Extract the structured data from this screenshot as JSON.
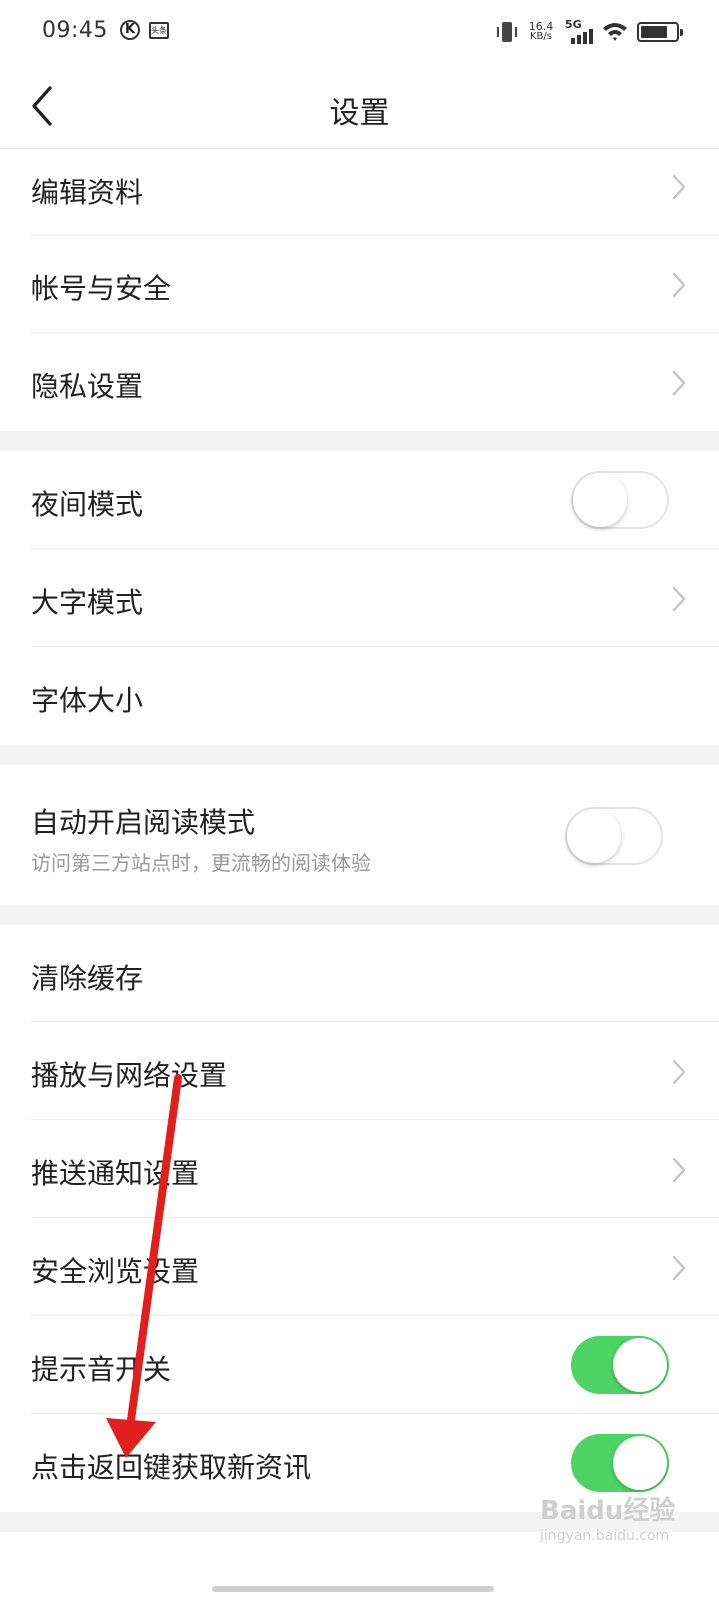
{
  "status_bar": {
    "time": "09:45",
    "k_badge": "K",
    "app_badge": "头条",
    "net_speed_value": "16.4",
    "net_speed_unit": "KB/s",
    "network_type": "5G",
    "icons": [
      "vibrate-icon",
      "signal-icon",
      "wifi-icon",
      "battery-icon"
    ],
    "battery_level": 0.75
  },
  "header": {
    "title": "设置",
    "back_icon": "chevron-left-icon"
  },
  "sections": [
    {
      "items": [
        {
          "label": "编辑资料",
          "control": "chevron"
        },
        {
          "label": "帐号与安全",
          "control": "chevron"
        },
        {
          "label": "隐私设置",
          "control": "chevron"
        }
      ]
    },
    {
      "items": [
        {
          "label": "夜间模式",
          "control": "toggle",
          "on": false
        },
        {
          "label": "大字模式",
          "control": "chevron"
        },
        {
          "label": "字体大小",
          "control": "none"
        }
      ]
    },
    {
      "items": [
        {
          "label": "自动开启阅读模式",
          "sublabel": "访问第三方站点时，更流畅的阅读体验",
          "control": "toggle",
          "on": false
        }
      ]
    },
    {
      "items": [
        {
          "label": "清除缓存",
          "control": "none"
        },
        {
          "label": "播放与网络设置",
          "control": "chevron"
        },
        {
          "label": "推送通知设置",
          "control": "chevron"
        },
        {
          "label": "安全浏览设置",
          "control": "chevron"
        },
        {
          "label": "提示音开关",
          "control": "toggle",
          "on": true
        },
        {
          "label": "点击返回键获取新资讯",
          "control": "toggle",
          "on": true
        }
      ]
    }
  ],
  "colors": {
    "toggle_on": "#4cd464",
    "section_gap": "#f4f4f4",
    "annotation_arrow": "#e0201e"
  },
  "watermark": {
    "text": "Baidu经验",
    "subtext": "jingyan.baidu.com"
  }
}
